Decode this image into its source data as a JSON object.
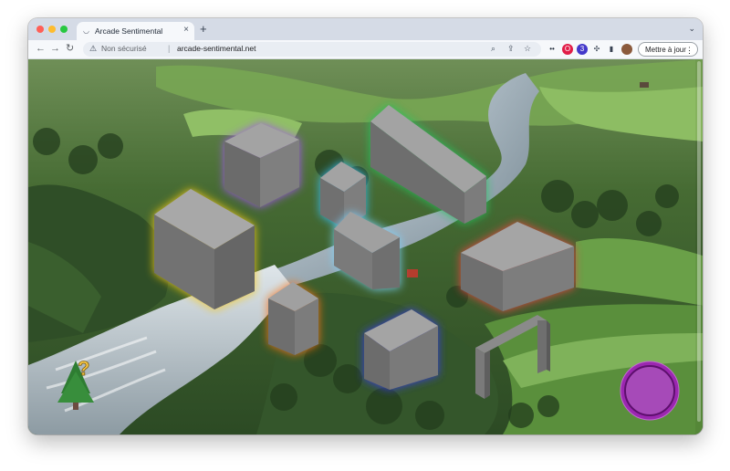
{
  "browser": {
    "tab": {
      "favicon": "sentimental-favicon-icon",
      "title": "Arcade Sentimental"
    },
    "new_tab_icon": "plus-icon",
    "tabs_menu_icon": "chevron-down-icon",
    "nav": {
      "back_icon": "back-arrow-icon",
      "forward_icon": "forward-arrow-icon",
      "reload_icon": "reload-icon"
    },
    "address": {
      "security_icon": "warning-triangle-icon",
      "security_label": "Non sécurisé",
      "url": "arcade-sentimental.net"
    },
    "omnibox_icons": [
      "zoom-icon",
      "share-icon",
      "star-icon"
    ],
    "extensions": [
      {
        "name": "extension-icon",
        "color": "#1f2937"
      },
      {
        "name": "opera-extension-icon",
        "color": "#e11d48"
      },
      {
        "name": "badge-extension-icon",
        "color": "#4338ca",
        "badge": "3"
      },
      {
        "name": "puzzle-icon",
        "color": "#374151"
      },
      {
        "name": "sidebar-icon",
        "color": "#374151"
      },
      {
        "name": "profile-avatar",
        "color": "#8b5a3c"
      }
    ],
    "update_button": "Mettre à jour",
    "menu_icon": "vertical-dots-icon"
  },
  "page": {
    "background": "aerial-river-valley-photo",
    "character_icon": "tree-character-icon",
    "character_symbol": "?",
    "blocks": [
      {
        "name": "purple-glow-block",
        "glow": "#a855f7"
      },
      {
        "name": "green-glow-block",
        "glow": "#22c55e"
      },
      {
        "name": "cyan-glow-block",
        "glow": "#38bdf8"
      },
      {
        "name": "yellow-glow-block",
        "glow": "#facc15"
      },
      {
        "name": "light-blue-glow-block",
        "glow": "#7dd3fc"
      },
      {
        "name": "red-glow-block",
        "glow": "#ef4444"
      },
      {
        "name": "orange-glow-block",
        "glow": "#f97316"
      },
      {
        "name": "blue-glow-block",
        "glow": "#3b3bf0"
      }
    ],
    "portal": "stone-portal",
    "action_button": {
      "color": "#9b27b0",
      "icon": "action-button-icon"
    }
  }
}
